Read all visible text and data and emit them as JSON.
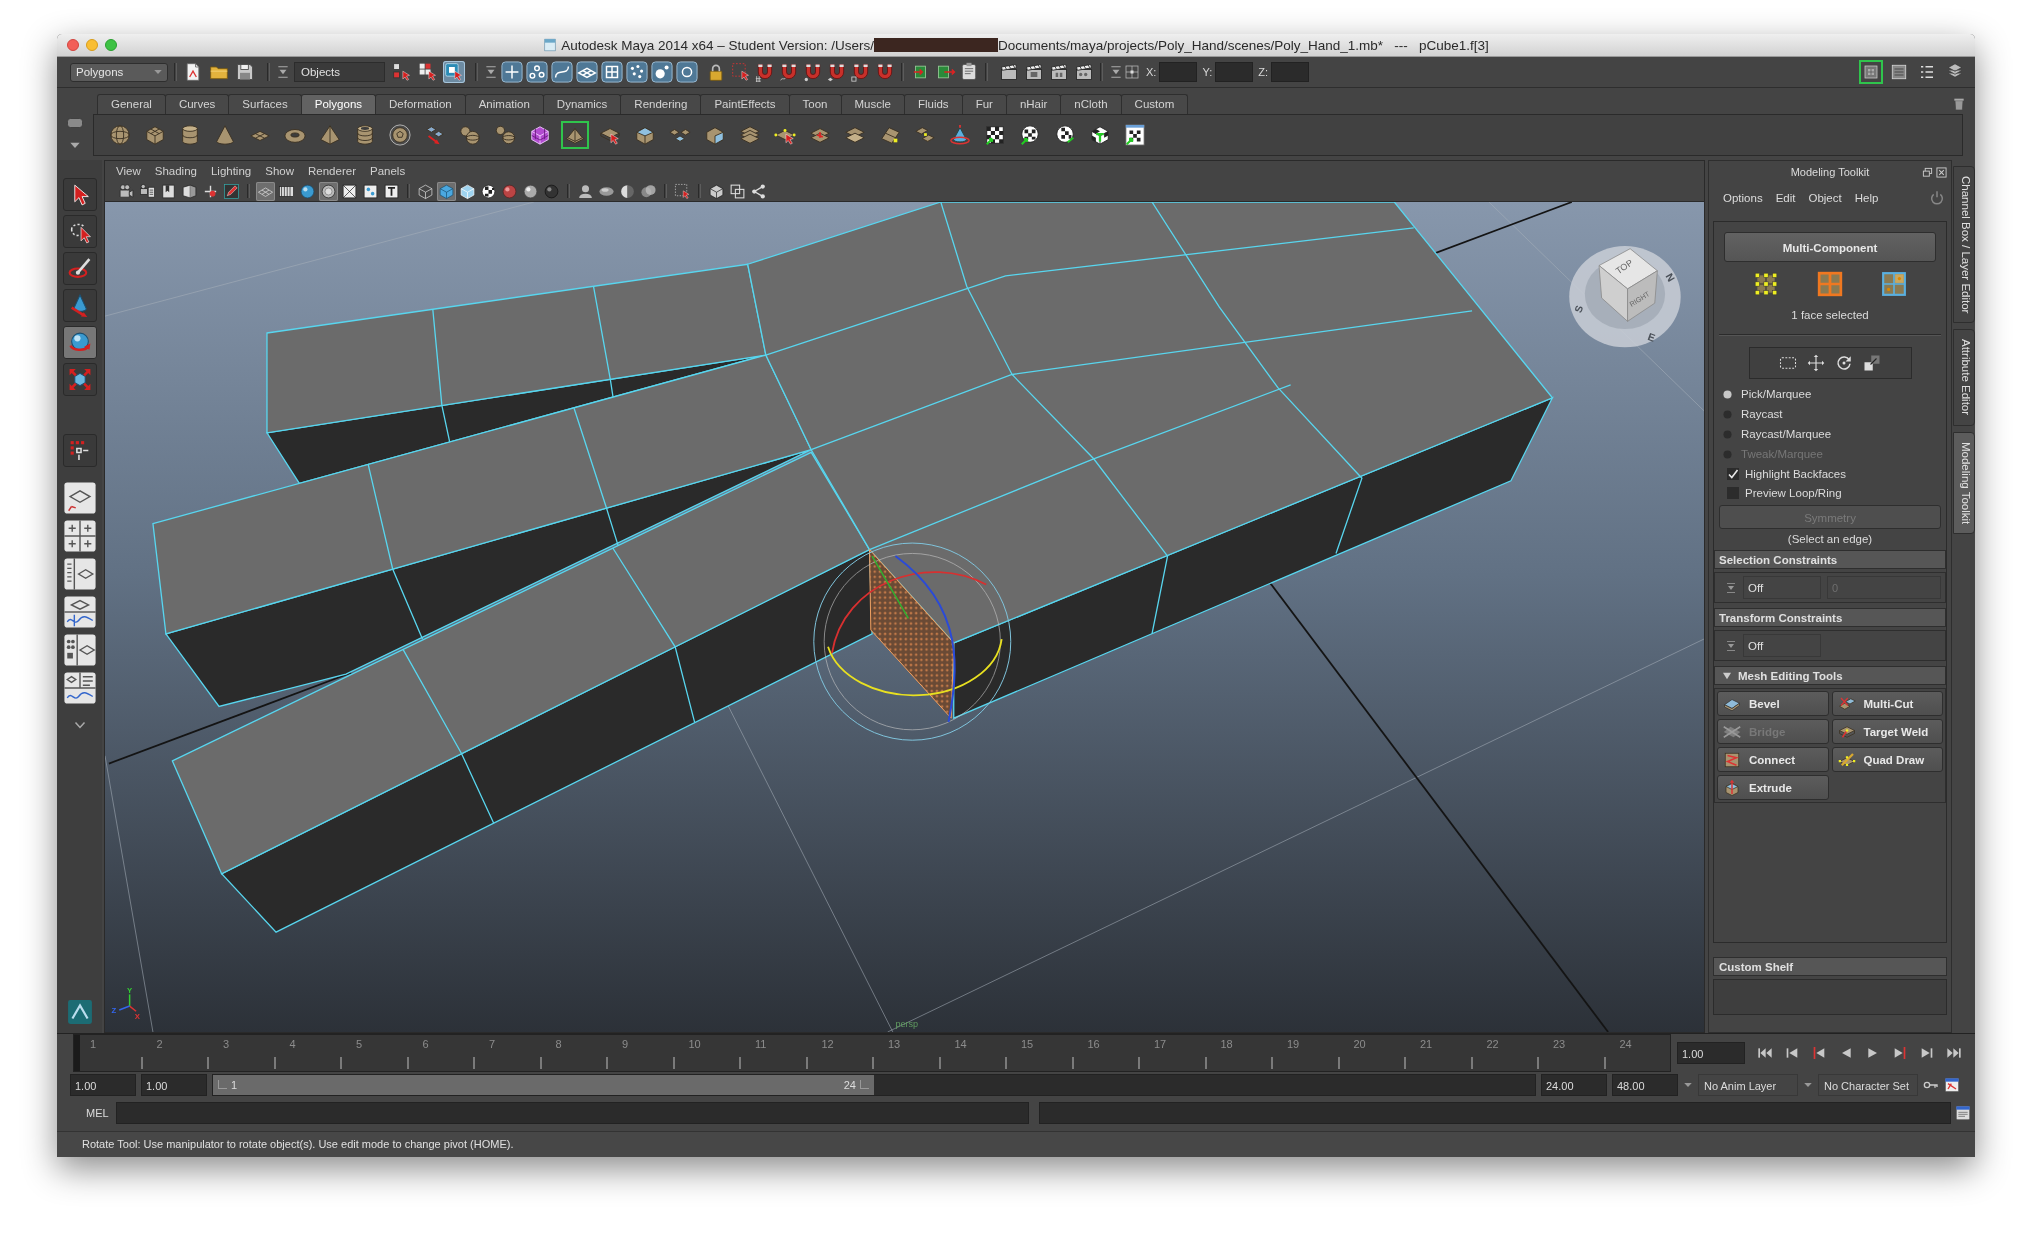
{
  "window": {
    "title": [
      "Autodesk Maya 2014 x64 – Student Version: /Users/",
      "Documents/maya/projects/Poly_Hand/scenes/Poly_Hand_1.mb*   ---   pCube1.f[3]"
    ]
  },
  "status_line": {
    "menu_set": "Polygons",
    "selection_mode": "Objects",
    "select_by": [
      {
        "kind": "hierarchy",
        "on": false
      },
      {
        "kind": "object",
        "on": false
      },
      {
        "kind": "component",
        "on": true
      }
    ],
    "coordinates": [
      {
        "label": "X:"
      },
      {
        "label": "Y:"
      },
      {
        "label": "Z:"
      }
    ],
    "panel_toggles": [
      {
        "kind": "modeling-toolkit",
        "on": true
      },
      {
        "kind": "attribute-editor",
        "on": false
      },
      {
        "kind": "tool-settings",
        "on": false
      },
      {
        "kind": "channel-box",
        "on": false
      }
    ]
  },
  "shelf": {
    "tabs": [
      {
        "label": "General",
        "selected": false
      },
      {
        "label": "Curves",
        "selected": false
      },
      {
        "label": "Surfaces",
        "selected": false
      },
      {
        "label": "Polygons",
        "selected": true
      },
      {
        "label": "Deformation",
        "selected": false
      },
      {
        "label": "Animation",
        "selected": false
      },
      {
        "label": "Dynamics",
        "selected": false
      },
      {
        "label": "Rendering",
        "selected": false
      },
      {
        "label": "PaintEffects",
        "selected": false
      },
      {
        "label": "Toon",
        "selected": false
      },
      {
        "label": "Muscle",
        "selected": false
      },
      {
        "label": "Fluids",
        "selected": false
      },
      {
        "label": "Fur",
        "selected": false
      },
      {
        "label": "nHair",
        "selected": false
      },
      {
        "label": "nCloth",
        "selected": false
      },
      {
        "label": "Custom",
        "selected": false
      }
    ],
    "tools": [
      {
        "kind": "sphere",
        "on": false
      },
      {
        "kind": "cube",
        "on": false
      },
      {
        "kind": "cylinder",
        "on": false
      },
      {
        "kind": "cone",
        "on": false
      },
      {
        "kind": "plane",
        "on": false
      },
      {
        "kind": "torus",
        "on": false
      },
      {
        "kind": "pyramid",
        "on": false
      },
      {
        "kind": "pipe",
        "on": false
      },
      {
        "kind": "polyhedron",
        "on": false
      },
      {
        "kind": "tiles-arrow",
        "on": false
      },
      {
        "kind": "combine",
        "on": false
      },
      {
        "kind": "separate",
        "on": false
      },
      {
        "kind": "smooth-proxy",
        "on": false
      },
      {
        "kind": "toolkit",
        "on": true
      },
      {
        "kind": "tile-cursor",
        "on": false
      },
      {
        "kind": "extrude-face",
        "on": false
      },
      {
        "kind": "split-tiles",
        "on": false
      },
      {
        "kind": "bevel-cube",
        "on": false
      },
      {
        "kind": "tile-stack",
        "on": false
      },
      {
        "kind": "tile-points",
        "on": false
      },
      {
        "kind": "tile-mark",
        "on": false
      },
      {
        "kind": "stacked-tiles",
        "on": false
      },
      {
        "kind": "tilted-tile",
        "on": false
      },
      {
        "kind": "tile-pair",
        "on": false
      },
      {
        "kind": "cone-axes",
        "on": false
      },
      {
        "kind": "checker-arrow",
        "on": false
      },
      {
        "kind": "checker-sphere",
        "on": false
      },
      {
        "kind": "checker-sphere-arrow",
        "on": false
      },
      {
        "kind": "checker-cube",
        "on": false
      },
      {
        "kind": "checker-page",
        "on": false
      }
    ]
  },
  "toolbox": [
    {
      "kind": "select",
      "selected": false
    },
    {
      "kind": "lasso",
      "selected": false
    },
    {
      "kind": "paint-select",
      "selected": false
    },
    {
      "kind": "soft-modify",
      "selected": false
    },
    {
      "kind": "rotate",
      "selected": true
    },
    {
      "kind": "scale",
      "selected": false
    },
    {
      "kind": "show-manipulator",
      "selected": false
    }
  ],
  "viewport": {
    "menus": [
      "View",
      "Shading",
      "Lighting",
      "Show",
      "Renderer",
      "Panels"
    ],
    "toolbar": [
      [
        {
          "kind": "camera",
          "on": false
        },
        {
          "kind": "camera-attributes",
          "on": false
        },
        {
          "kind": "bookmarks",
          "on": false
        },
        {
          "kind": "image-plane",
          "on": false
        },
        {
          "kind": "pan-zoom",
          "on": false
        },
        {
          "kind": "grease-pencil",
          "on": false
        }
      ],
      [
        {
          "kind": "grid",
          "on": true
        },
        {
          "kind": "film-gate",
          "on": false
        },
        {
          "kind": "resolution-gate",
          "on": false
        },
        {
          "kind": "field-chart",
          "on": true
        },
        {
          "kind": "safe-action",
          "on": false
        },
        {
          "kind": "safe-title",
          "on": false
        },
        {
          "kind": "hud",
          "on": false
        }
      ],
      [
        {
          "kind": "wireframe",
          "on": false
        },
        {
          "kind": "smooth-shade",
          "on": true
        },
        {
          "kind": "wire-on-shaded",
          "on": false
        },
        {
          "kind": "textured",
          "on": false
        },
        {
          "kind": "default-light",
          "on": false
        },
        {
          "kind": "all-lights",
          "on": false
        },
        {
          "kind": "shadows",
          "on": false
        }
      ],
      [
        {
          "kind": "bust",
          "on": false
        },
        {
          "kind": "occlusion",
          "on": false
        },
        {
          "kind": "half-sphere",
          "on": false
        },
        {
          "kind": "blur",
          "on": false
        }
      ],
      [
        {
          "kind": "region-select",
          "on": false
        }
      ],
      [
        {
          "kind": "cube-outline",
          "on": false
        },
        {
          "kind": "overlap",
          "on": false
        },
        {
          "kind": "node-graph",
          "on": false
        }
      ]
    ],
    "view_cube": {
      "top": "TOP",
      "side": "RIGHT",
      "compass": [
        "N",
        "E",
        "S"
      ]
    },
    "axis_labels": {
      "y": "Y",
      "x": "X",
      "z": "Z"
    },
    "camera": "persp"
  },
  "modeling_toolkit": {
    "title": "Modeling Toolkit",
    "menus": [
      "Options",
      "Edit",
      "Object",
      "Help"
    ],
    "mode": "Multi-Component",
    "selection_info": "1 face selected",
    "pick_modes": [
      {
        "label": "Pick/Marquee",
        "selected": true,
        "disabled": false
      },
      {
        "label": "Raycast",
        "selected": false,
        "disabled": false
      },
      {
        "label": "Raycast/Marquee",
        "selected": false,
        "disabled": false
      },
      {
        "label": "Tweak/Marquee",
        "selected": false,
        "disabled": true
      }
    ],
    "options": [
      {
        "label": "Highlight Backfaces",
        "checked": true
      },
      {
        "label": "Preview Loop/Ring",
        "checked": false
      }
    ],
    "symmetry": {
      "label": "Symmetry",
      "disabled": true
    },
    "symmetry_hint": "(Select an edge)",
    "constraints": [
      {
        "title": "Selection Constraints",
        "mode": "Off",
        "value": "0",
        "value_disabled": true
      },
      {
        "title": "Transform Constraints",
        "mode": "Off"
      }
    ],
    "mesh_tools": {
      "title": "Mesh Editing Tools",
      "expanded": true,
      "tools": [
        {
          "kind": "bevel",
          "label": "Bevel",
          "disabled": false
        },
        {
          "kind": "multi-cut",
          "label": "Multi-Cut",
          "disabled": false
        },
        {
          "kind": "bridge",
          "label": "Bridge",
          "disabled": true
        },
        {
          "kind": "target-weld",
          "label": "Target Weld",
          "disabled": false
        },
        {
          "kind": "connect",
          "label": "Connect",
          "disabled": false
        },
        {
          "kind": "quad-draw",
          "label": "Quad Draw",
          "disabled": false
        },
        {
          "kind": "extrude",
          "label": "Extrude",
          "disabled": false
        }
      ]
    },
    "custom_shelf": {
      "title": "Custom Shelf"
    }
  },
  "side_tabs": [
    {
      "label": "Channel Box / Layer Editor",
      "selected": false
    },
    {
      "label": "Attribute Editor",
      "selected": false
    },
    {
      "label": "Modeling Toolkit",
      "selected": true
    }
  ],
  "time_slider": {
    "frames": [
      "1",
      "2",
      "3",
      "4",
      "5",
      "6",
      "7",
      "8",
      "9",
      "10",
      "11",
      "12",
      "13",
      "14",
      "15",
      "16",
      "17",
      "18",
      "19",
      "20",
      "21",
      "22",
      "23",
      "24"
    ],
    "level": 0,
    "current_time": "1.00"
  },
  "range_slider": {
    "start_time": "1.00",
    "playback_start": "1.00",
    "bar": {
      "start_label": "1",
      "end_label": "24",
      "level": 0.5
    },
    "playback_end": "24.00",
    "end_time": "48.00",
    "anim_layer": "No Anim Layer",
    "character_set": "No Character Set"
  },
  "command_line": {
    "language": "MEL"
  },
  "help_line": "Rotate Tool: Use manipulator to rotate object(s). Use edit mode to change pivot (HOME)."
}
